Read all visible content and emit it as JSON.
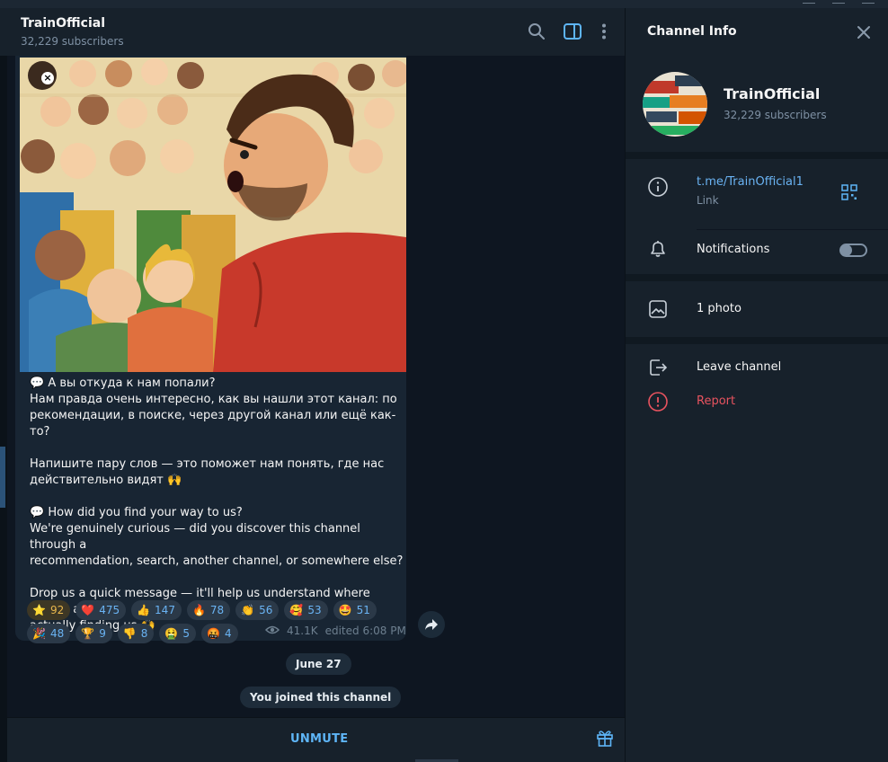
{
  "channel": {
    "name": "TrainOfficial",
    "subscribers": "32,229 subscribers"
  },
  "message": {
    "text_ru_q": "💬 А вы откуда к нам попали?",
    "text_ru_body": "Нам правда очень интересно, как вы нашли этот канал: по\nрекомендации, в поиске, через другой канал или ещё как-то?",
    "text_ru_ask": "Напишите пару слов — это поможет нам понять, где нас\nдействительно видят 🙌",
    "text_en_q": "💬 How did you find your way to us?",
    "text_en_body": "We're genuinely curious — did you discover this channel through a\nrecommendation, search, another channel, or somewhere else?",
    "text_en_ask": "Drop us a quick message — it'll help us understand where people are\nactually finding us 🙌",
    "reactions_row1": [
      {
        "emoji": "⭐",
        "count": "92"
      },
      {
        "emoji": "❤️",
        "count": "475"
      },
      {
        "emoji": "👍",
        "count": "147"
      },
      {
        "emoji": "🔥",
        "count": "78"
      },
      {
        "emoji": "👏",
        "count": "56"
      },
      {
        "emoji": "🥰",
        "count": "53"
      },
      {
        "emoji": "🤩",
        "count": "51"
      }
    ],
    "reactions_row2": [
      {
        "emoji": "🎉",
        "count": "48"
      },
      {
        "emoji": "🏆",
        "count": "9"
      },
      {
        "emoji": "👎",
        "count": "8"
      },
      {
        "emoji": "🤮",
        "count": "5"
      },
      {
        "emoji": "🤬",
        "count": "4"
      }
    ],
    "views": "41.1K",
    "edited": "edited 6:08 PM"
  },
  "date_pill": "June 27",
  "service_pill": "You joined this channel",
  "bottom": {
    "unmute_label": "UNMUTE"
  },
  "info_panel": {
    "title": "Channel Info",
    "name": "TrainOfficial",
    "subscribers": "32,229 subscribers",
    "link": "t.me/TrainOfficial1",
    "link_label": "Link",
    "notifications": "Notifications",
    "notifications_on": false,
    "photos": "1 photo",
    "leave": "Leave channel",
    "report": "Report"
  },
  "colors": {
    "accent": "#6ab3f3",
    "danger": "#e8535f",
    "background": "#0e1621",
    "panel": "#17212b",
    "bubble": "#182533"
  },
  "icons": [
    "search-icon",
    "sidebar-toggle-icon",
    "more-vertical-icon",
    "close-icon",
    "info-icon",
    "qr-code-icon",
    "bell-icon",
    "photo-icon",
    "leave-icon",
    "report-icon",
    "share-icon",
    "gift-icon",
    "eye-icon"
  ]
}
